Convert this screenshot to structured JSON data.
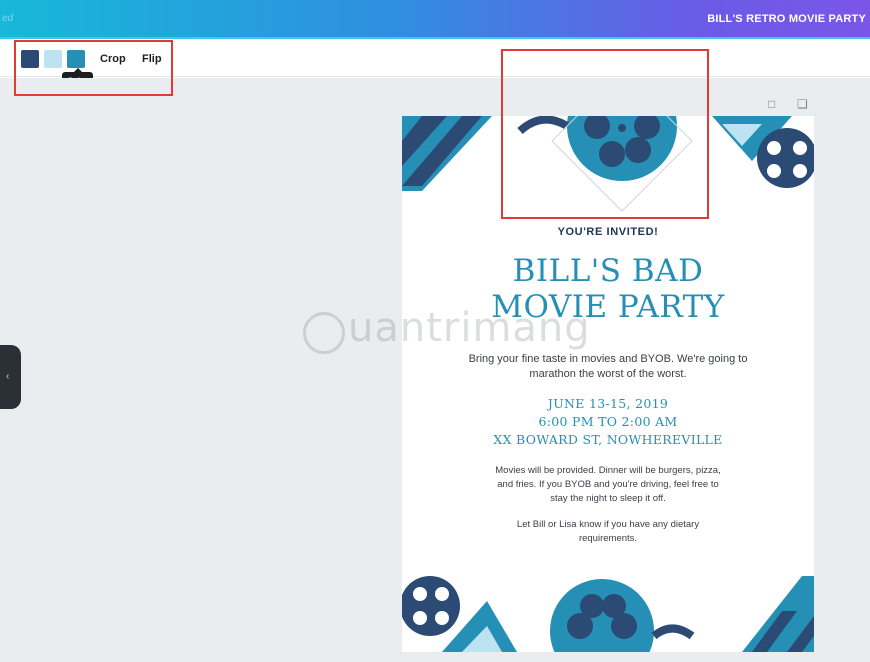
{
  "header": {
    "left_text": "ed",
    "title": "BILL'S RETRO MOVIE PARTY"
  },
  "toolbar": {
    "swatches": [
      {
        "name": "dark navy",
        "color": "#2b4a74"
      },
      {
        "name": "light blue",
        "color": "#bde3f3"
      },
      {
        "name": "teal blue",
        "color": "#268fb6"
      }
    ],
    "crop_label": "Crop",
    "flip_label": "Flip",
    "tooltip": "Color"
  },
  "canvas": {
    "page_icons": [
      "comment-icon",
      "duplicate-icon"
    ],
    "side_handle": "collapse-handle"
  },
  "invitation": {
    "invited": "YOU'RE INVITED!",
    "title_line1": "BILL'S BAD",
    "title_line2": "MOVIE PARTY",
    "intro": "Bring your fine taste in movies and BYOB. We're going to marathon the worst of the worst.",
    "date": "JUNE 13-15, 2019",
    "time": "6:00 PM TO 2:00 AM",
    "address": "XX BOWARD ST, NOWHEREVILLE",
    "details": "Movies will be provided. Dinner will be burgers, pizza, and fries. If you BYOB and you're driving, feel free to stay the night to sleep it off.",
    "dietary": "Let Bill or Lisa know if you have any dietary requirements."
  },
  "watermark": "uantrimang",
  "colors": {
    "navy": "#2b4a74",
    "teal": "#268fb6",
    "light": "#bde3f3",
    "highlight": "#e53935"
  }
}
